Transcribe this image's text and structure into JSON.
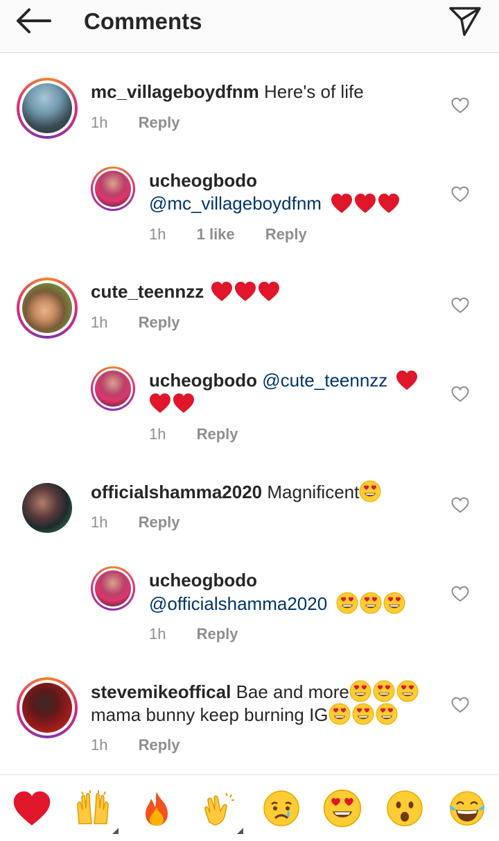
{
  "header": {
    "title": "Comments"
  },
  "comments": [
    {
      "user": "mc_villageboydfnm",
      "text": "Here's of life",
      "time": "1h",
      "reply": "Reply"
    },
    {
      "user": "ucheogbodo",
      "mention": "@mc_villageboydfnm",
      "time": "1h",
      "likes": "1 like",
      "reply": "Reply"
    },
    {
      "user": "cute_teennzz",
      "time": "1h",
      "reply": "Reply"
    },
    {
      "user": "ucheogbodo",
      "mention": "@cute_teennzz",
      "time": "1h",
      "reply": "Reply"
    },
    {
      "user": "officialshamma2020",
      "text": "Magnificent",
      "time": "1h",
      "reply": "Reply"
    },
    {
      "user": "ucheogbodo",
      "mention": "@officialshamma2020",
      "time": "1h",
      "reply": "Reply"
    },
    {
      "user": "stevemikeoffical",
      "text": "Bae and more",
      "text2": "mama bunny keep burning IG",
      "time": "1h",
      "reply": "Reply"
    }
  ],
  "emoji_bar": [
    "red-heart",
    "raising-hands",
    "fire",
    "clapping-hands",
    "crying-face",
    "heart-eyes-face",
    "astonished-face",
    "tears-of-joy-face"
  ],
  "colors": {
    "heart": "#e0162b",
    "mention": "#003569",
    "meta": "#8e8e8e"
  }
}
